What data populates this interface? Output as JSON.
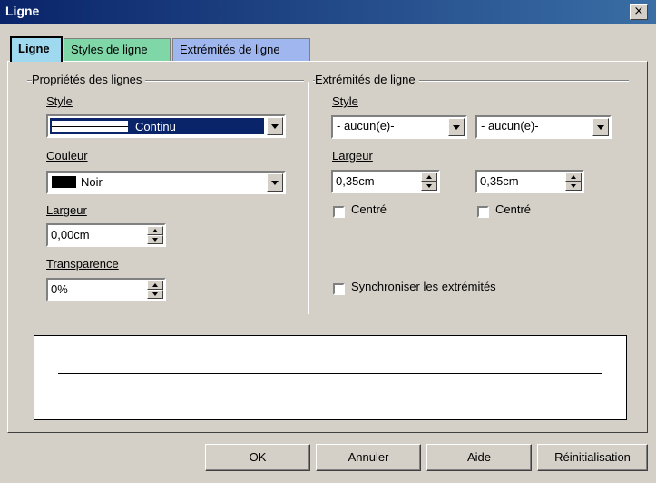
{
  "window": {
    "title": "Ligne",
    "close_glyph": "×"
  },
  "tabs": [
    {
      "label": "Ligne",
      "active": true
    },
    {
      "label": "Styles de ligne",
      "active": false
    },
    {
      "label": "Extrémités de ligne",
      "active": false
    }
  ],
  "line_props": {
    "group_title": "Propriétés des lignes",
    "style": {
      "label": "Style",
      "value": "Continu"
    },
    "color": {
      "label": "Couleur",
      "value": "Noir",
      "swatch": "#000000"
    },
    "width": {
      "label": "Largeur",
      "value": "0,00cm"
    },
    "transparency": {
      "label": "Transparence",
      "value": "0%"
    }
  },
  "line_ends": {
    "group_title": "Extrémités de ligne",
    "style_label": "Style",
    "start_style": "- aucun(e)-",
    "end_style": "- aucun(e)-",
    "width_label": "Largeur",
    "start_width": "0,35cm",
    "end_width": "0,35cm",
    "start_centered_label": "Centré",
    "end_centered_label": "Centré",
    "sync_label": "Synchroniser les extrémités"
  },
  "buttons": {
    "ok": "OK",
    "cancel": "Annuler",
    "help": "Aide",
    "reset": "Réinitialisation"
  },
  "colors": {
    "titlebar_start": "#0a246a",
    "titlebar_end": "#3a6ea5",
    "tab_ligne": "#9fd9f0",
    "tab_styles": "#7fd7a8",
    "tab_ext": "#9fb6ef",
    "selection": "#0a246a"
  }
}
